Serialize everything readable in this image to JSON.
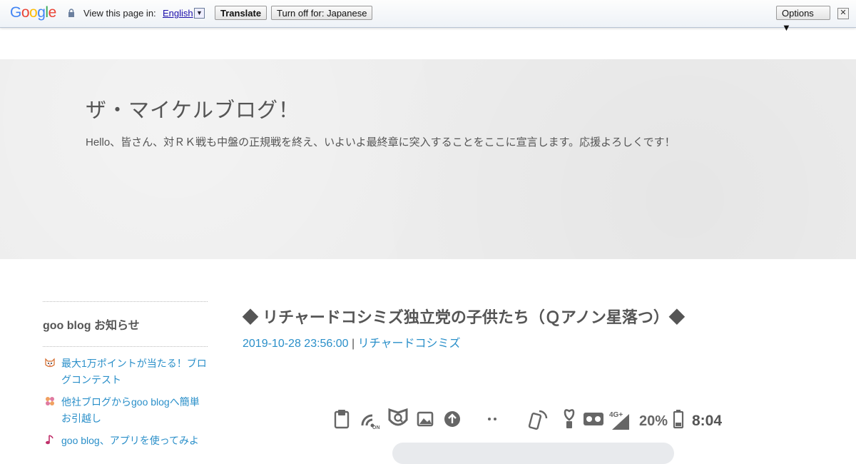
{
  "translate_bar": {
    "logo": "Google",
    "view_label": "View this page in:",
    "language": "English",
    "language_dropdown_glyph": "▼",
    "translate_button": "Translate",
    "turnoff_button": "Turn off for: Japanese",
    "options_button": "Options ▼",
    "close_glyph": "✕",
    "logo_colors": [
      "#4285f4",
      "#ea4335",
      "#fbbc05",
      "#4285f4",
      "#34a853",
      "#ea4335"
    ]
  },
  "header": {
    "title": "ザ・マイケルブログ！",
    "description": "Hello、皆さん、対ＲＫ戦も中盤の正規戦を終え、いよいよ最終章に突入することをここに宣言します。応援よろしくです！"
  },
  "sidebar": {
    "section_title": "goo blog お知らせ",
    "items": [
      {
        "label": "最大1万ポイントが当たる！ブログコンテスト",
        "icon": "cat-face-icon"
      },
      {
        "label": "他社ブログからgoo blogへ簡単お引越し",
        "icon": "flower-icon"
      },
      {
        "label": "goo blog、アプリを使ってみよ",
        "icon": "music-note-icon"
      }
    ]
  },
  "post": {
    "title": "◆ リチャードコシミズ独立党の子供たち（Ｑアノン星落つ）◆",
    "date": "2019-10-28 23:56:00",
    "separator": "|",
    "category": "リチャードコシミズ"
  },
  "status_bar": {
    "battery_percent": "20%",
    "network": "4G+",
    "time": "8:04"
  },
  "colors": {
    "link": "#2a8fc9",
    "header_bg": "#ededed",
    "text": "#555555"
  }
}
